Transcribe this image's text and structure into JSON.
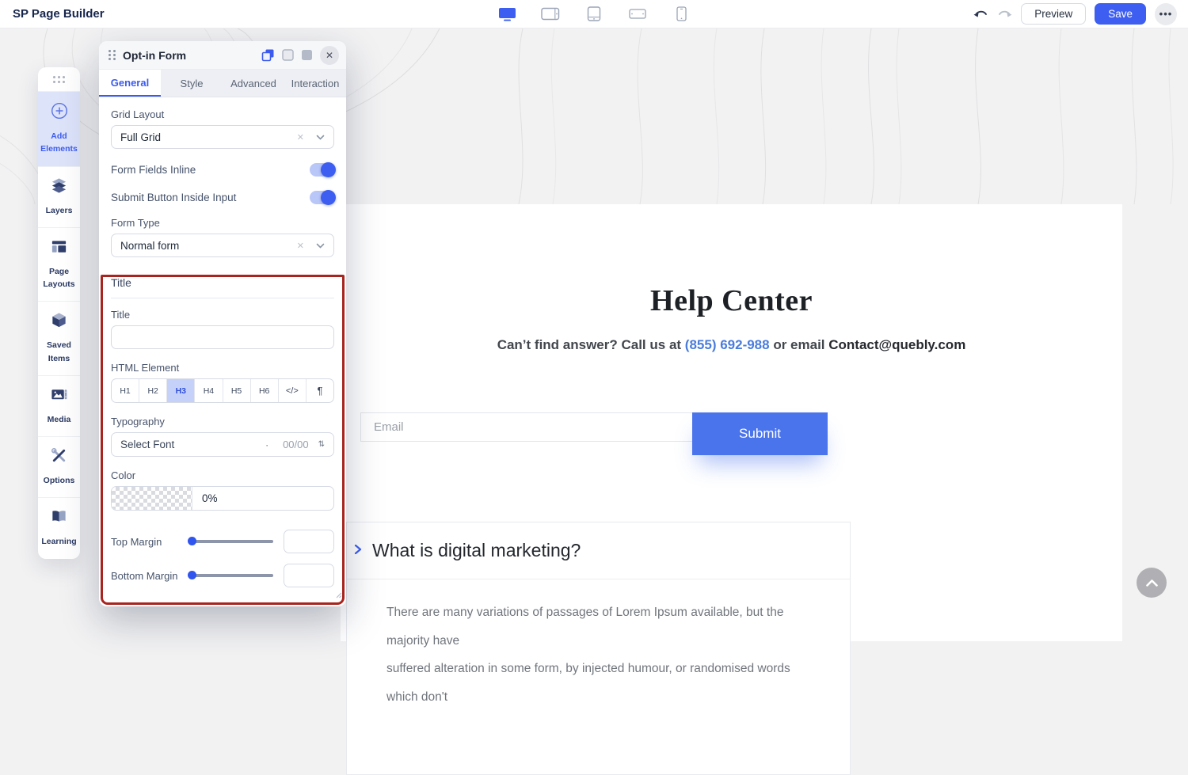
{
  "colors": {
    "accent": "#3d5ef0",
    "submit": "#4a74ec",
    "highlight": "#a8241e",
    "link": "#4a7cdb"
  },
  "topbar": {
    "title": "SP Page Builder",
    "preview_label": "Preview",
    "save_label": "Save",
    "more_label": "•••",
    "devices": [
      "desktop",
      "tablet-landscape",
      "tablet-portrait",
      "mobile-landscape",
      "mobile-portrait"
    ],
    "active_device": "desktop"
  },
  "sidebar": {
    "items": [
      {
        "label": "Add Elements",
        "active": true
      },
      {
        "label": "Layers"
      },
      {
        "label": "Page Layouts"
      },
      {
        "label": "Saved Items"
      },
      {
        "label": "Media"
      },
      {
        "label": "Options"
      },
      {
        "label": "Learning"
      }
    ]
  },
  "panel": {
    "title": "Opt-in Form",
    "close_glyph": "✕",
    "tabs": [
      {
        "label": "General",
        "active": true
      },
      {
        "label": "Style"
      },
      {
        "label": "Advanced"
      },
      {
        "label": "Interaction"
      }
    ],
    "grid_layout": {
      "label": "Grid Layout",
      "value": "Full Grid",
      "clear_glyph": "✕"
    },
    "form_fields_inline": {
      "label": "Form Fields Inline",
      "on": true
    },
    "submit_inside_input": {
      "label": "Submit Button Inside Input",
      "on": true
    },
    "form_type": {
      "label": "Form Type",
      "value": "Normal form",
      "clear_glyph": "✕"
    },
    "title_section": {
      "heading": "Title",
      "title_label": "Title",
      "title_value": "",
      "html_element_label": "HTML Element",
      "html_options": [
        "H1",
        "H2",
        "H3",
        "H4",
        "H5",
        "H6",
        "</>",
        "¶"
      ],
      "html_active": "H3",
      "typography_label": "Typography",
      "font_placeholder": "Select Font",
      "divider_glyph": "·",
      "font_size_value": "00/00",
      "lineheight_icon_glyph": "⇅",
      "color_label": "Color",
      "color_value": "0%",
      "top_margin_label": "Top Margin",
      "top_margin_value": "",
      "bottom_margin_label": "Bottom Margin",
      "bottom_margin_value": ""
    }
  },
  "page": {
    "title": "Help Center",
    "subtitle_prefix": "Can’t find answer? Call us at ",
    "phone": "(855) 692-988",
    "subtitle_middle": " or email ",
    "email": "Contact@quebly.com",
    "form": {
      "placeholder": "Email",
      "submit_label": "Submit"
    },
    "faq": {
      "question": "What is digital marketing?",
      "answer_lines": [
        "There are many variations of passages of Lorem Ipsum available, but the majority have",
        "suffered alteration in some form, by injected humour, or randomised words which don't"
      ]
    }
  }
}
